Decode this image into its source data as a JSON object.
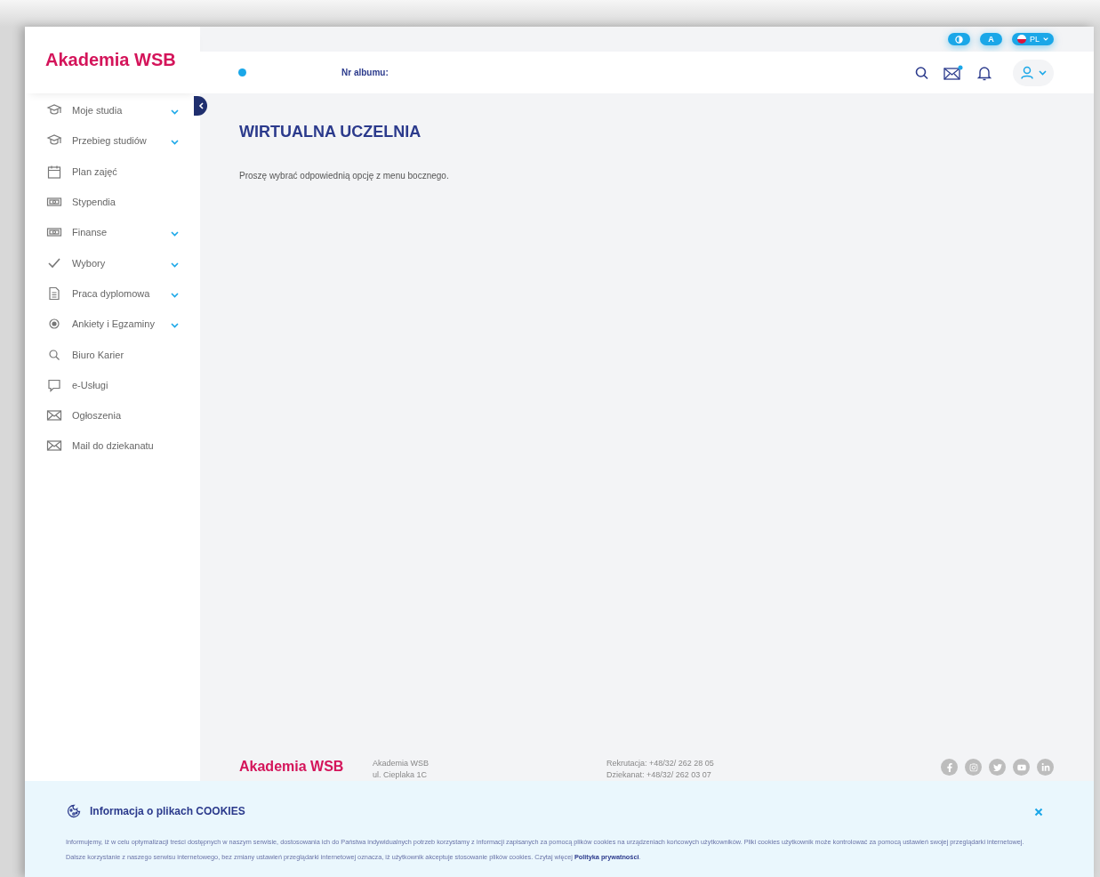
{
  "brand": {
    "logo": "Akademia WSB"
  },
  "top_controls": {
    "contrast_selected": false,
    "font_label": "A",
    "language": "PL"
  },
  "header": {
    "status_dot": true,
    "album_label": "Nr albumu:",
    "mail_unread": true
  },
  "sidebar": {
    "items": [
      {
        "label": "Moje studia",
        "expandable": true
      },
      {
        "label": "Przebieg studiów",
        "expandable": true
      },
      {
        "label": "Plan zajęć",
        "expandable": false
      },
      {
        "label": "Stypendia",
        "expandable": false
      },
      {
        "label": "Finanse",
        "expandable": true
      },
      {
        "label": "Wybory",
        "expandable": true
      },
      {
        "label": "Praca dyplomowa",
        "expandable": true
      },
      {
        "label": "Ankiety i Egzaminy",
        "expandable": true
      },
      {
        "label": "Biuro Karier",
        "expandable": false
      },
      {
        "label": "e-Usługi",
        "expandable": false
      },
      {
        "label": "Ogłoszenia",
        "expandable": false
      },
      {
        "label": "Mail do dziekanatu",
        "expandable": false
      }
    ]
  },
  "content": {
    "title": "WIRTUALNA UCZELNIA",
    "message": "Proszę wybrać odpowiednią opcję z menu bocznego."
  },
  "footer": {
    "logo": "Akademia WSB",
    "address": [
      "Akademia WSB",
      "ul. Cieplaka 1C"
    ],
    "contacts": [
      "Rekrutacja: +48/32/ 262 28 05",
      "Dziekanat: +48/32/ 262 03 07"
    ]
  },
  "cookies": {
    "title": "Informacja o plikach COOKIES",
    "text": "Informujemy, iż w celu optymalizacji treści dostępnych w naszym serwisie, dostosowania ich do Państwa indywidualnych potrzeb korzystamy z informacji zapisanych za pomocą plików cookies na urządzeniach końcowych użytkowników. Pliki cookies użytkownik może kontrolować za pomocą ustawień swojej przeglądarki internetowej. Dalsze korzystanie z naszego serwisu internetowego, bez zmiany ustawień przeglądarki internetowej oznacza, iż użytkownik akceptuje stosowanie plików cookies. Czytaj więcej",
    "link": "Polityka prywatności",
    "text_after": "."
  }
}
